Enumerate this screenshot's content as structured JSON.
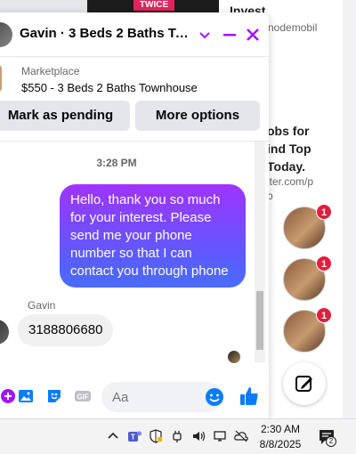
{
  "background": {
    "banner_text": "TWICE",
    "invest_heading": "Invest",
    "site_fragment": "nodemobil",
    "ad_text": "obs for\nind Top\nToday.",
    "ad_url": "iter.com/p\nb"
  },
  "chat_heads": [
    {
      "badge": "1"
    },
    {
      "badge": "1"
    },
    {
      "badge": "1"
    }
  ],
  "chat": {
    "title": "Gavin · 3 Beds 2 Baths Townhouse",
    "listing": {
      "source": "Marketplace",
      "title": "$550 - 3 Beds 2 Baths Townhouse"
    },
    "actions": {
      "mark_pending": "Mark as pending",
      "more_options": "More options"
    },
    "timestamp": "3:28 PM",
    "messages": {
      "outgoing": "Hello, thank you so much for your interest. Please send me your phone number so that I can contact you through phone",
      "sender_name": "Gavin",
      "incoming": "3188806680"
    },
    "composer": {
      "placeholder": "Aa",
      "gif_label": "GIF"
    },
    "accent_color": "#a313ff"
  },
  "taskbar": {
    "time": "2:30 AM",
    "date": "8/8/2025",
    "notification_count": "2"
  }
}
